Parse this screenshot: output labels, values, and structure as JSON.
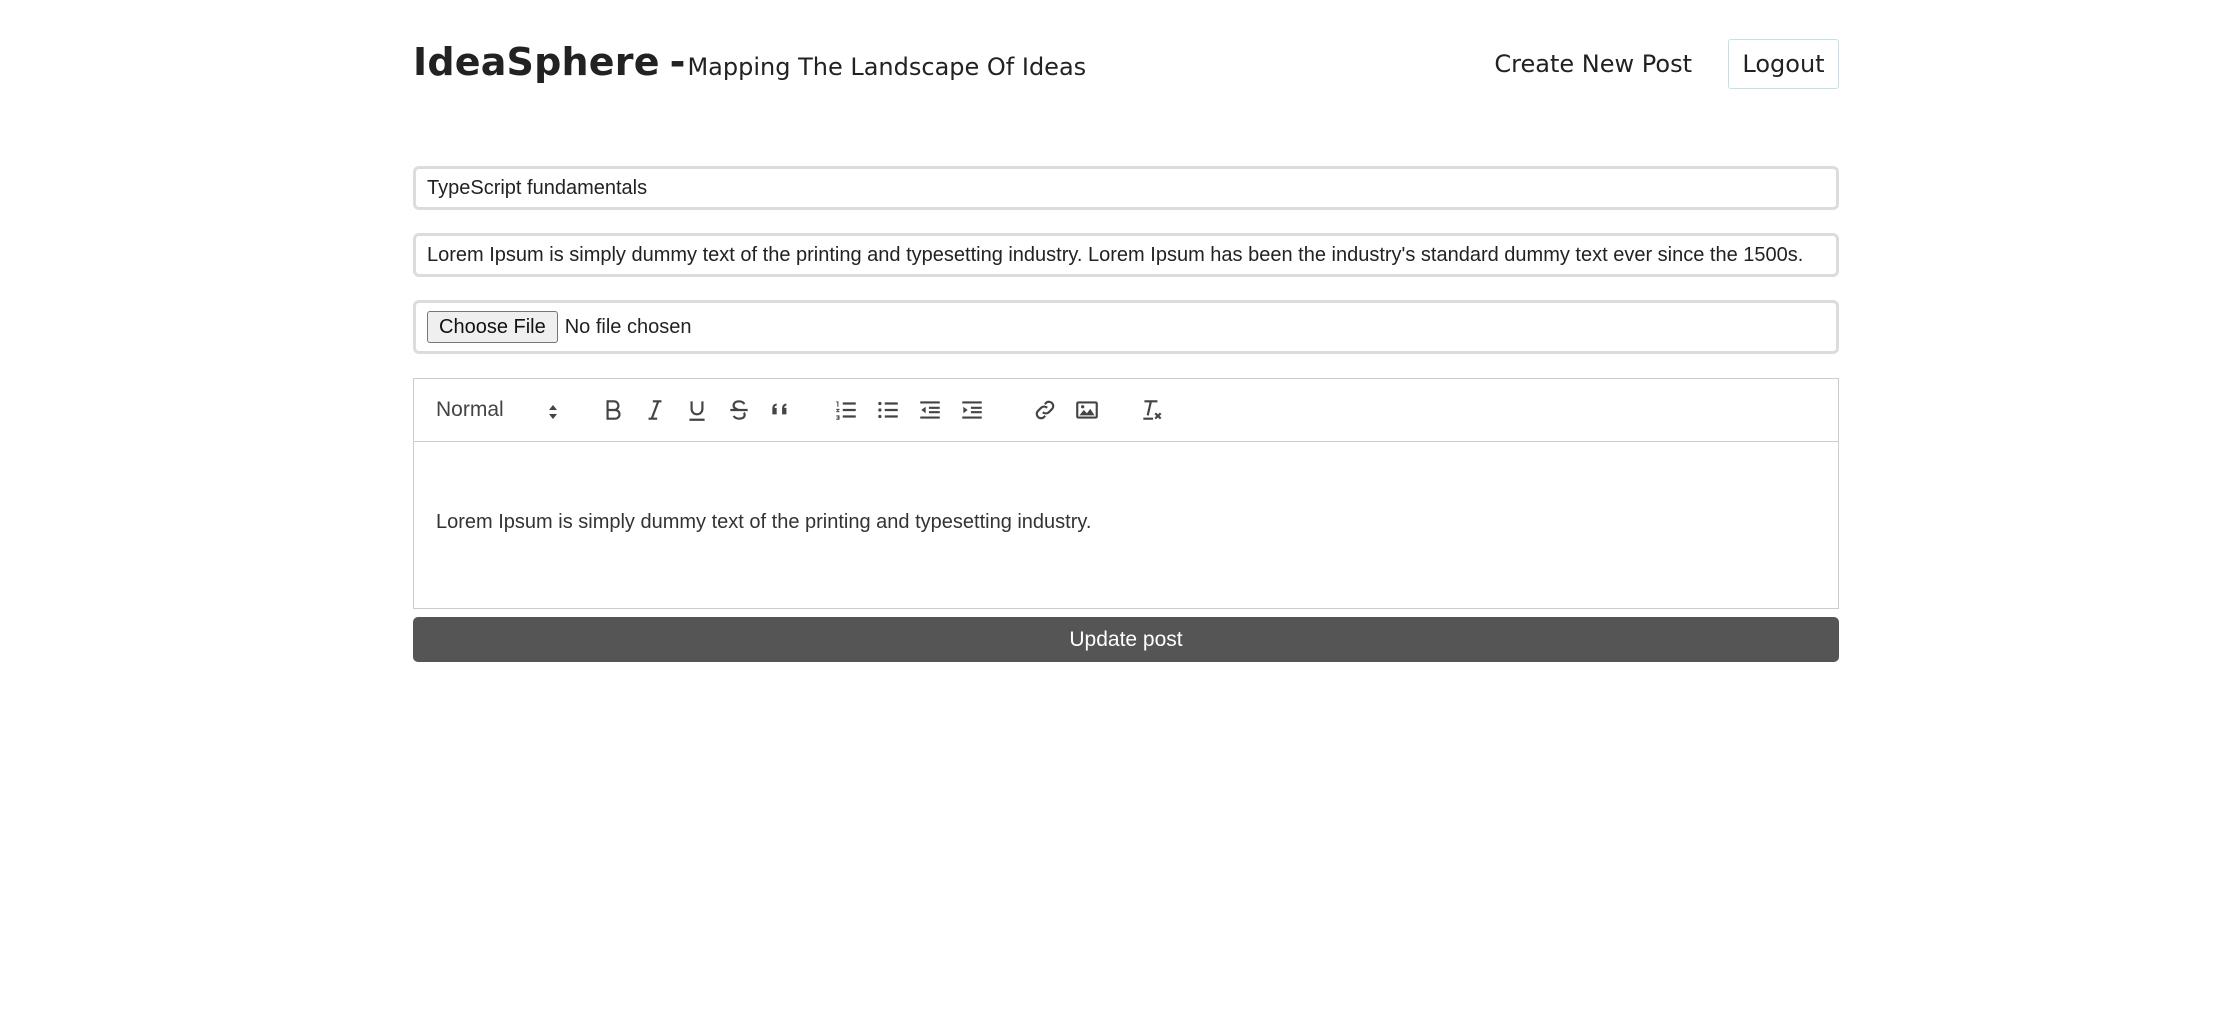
{
  "header": {
    "brand_name": "IdeaSphere",
    "brand_separator": "-",
    "tagline": "Mapping The Landscape Of Ideas",
    "nav_create": "Create New Post",
    "nav_logout": "Logout"
  },
  "form": {
    "title_value": "TypeScript fundamentals",
    "excerpt_value": "Lorem Ipsum is simply dummy text of the printing and typesetting industry. Lorem Ipsum has been the industry's standard dummy text ever since the 1500s.",
    "file_button_label": "Choose File",
    "file_status": "No file chosen",
    "submit_label": "Update post"
  },
  "editor": {
    "format_value": "Normal",
    "toolbar_icons": [
      "bold-icon",
      "italic-icon",
      "underline-icon",
      "strikethrough-icon",
      "blockquote-icon",
      "ordered-list-icon",
      "bullet-list-icon",
      "outdent-icon",
      "indent-icon",
      "link-icon",
      "image-icon",
      "clear-format-icon"
    ],
    "body_text": "Lorem Ipsum is simply dummy text of the printing and typesetting industry."
  }
}
